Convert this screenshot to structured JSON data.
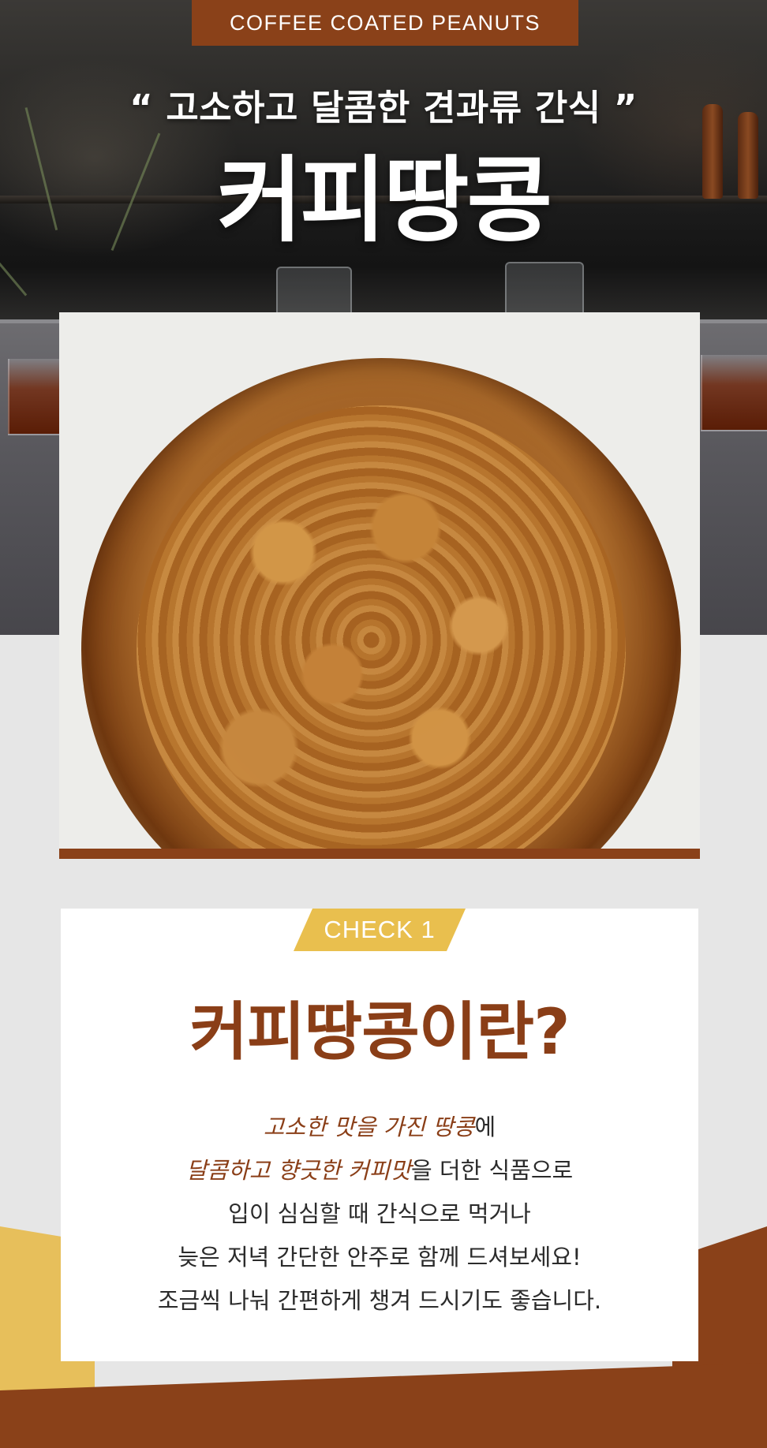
{
  "header": {
    "label": "COFFEE  COATED  PEANUTS",
    "tagline": "“ 고소하고 달콤한 견과류 간식 ”",
    "title": "커피땅콩"
  },
  "photo": {
    "icon": "bowl-of-coffee-peanuts"
  },
  "section": {
    "badge": "CHECK  1",
    "title": "커피땅콩이란?",
    "line1_highlight": "고소한 맛을 가진 땅콩",
    "line1_rest": "에",
    "line2_highlight": "달콤하고 향긋한 커피맛",
    "line2_rest": "을 더한 식품으로",
    "line3": "입이 심심할 때 간식으로 먹거나",
    "line4": "늦은 저녁 간단한 안주로 함께 드셔보세요!",
    "line5": "조금씩 나눠 간편하게 챙겨 드시기도 좋습니다."
  },
  "colors": {
    "brown": "#8a4119",
    "yellow": "#e9bf4e",
    "title_brown": "#8a3e17"
  }
}
